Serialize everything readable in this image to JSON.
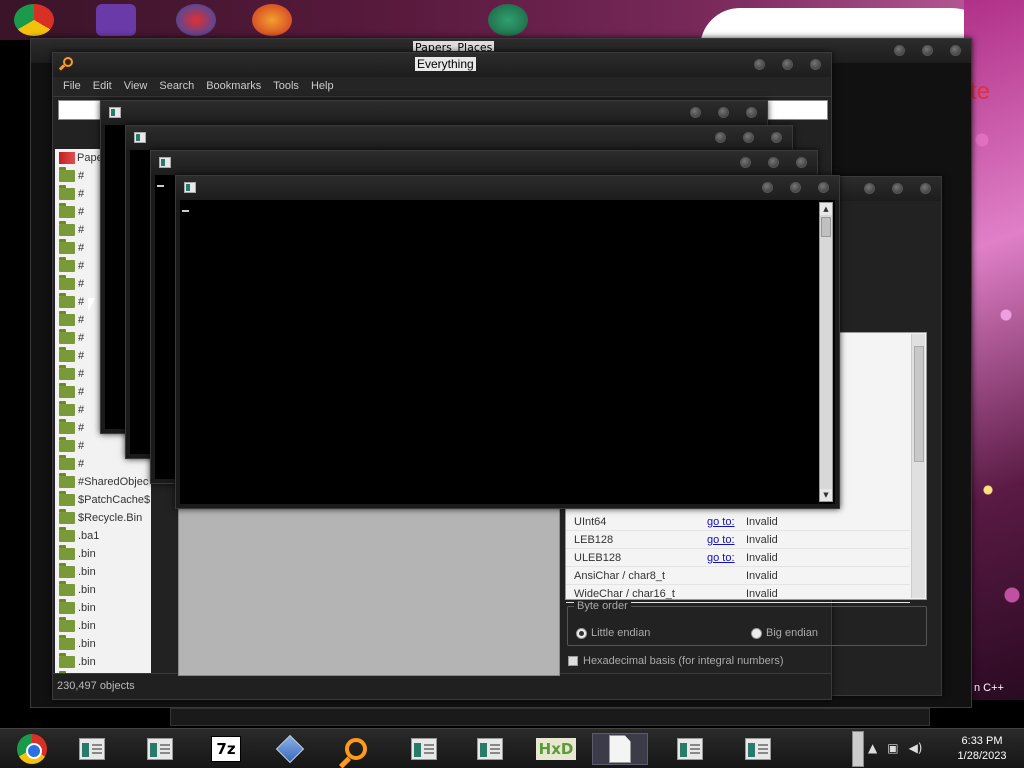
{
  "desktop": {
    "wallpaper_note_text": "te",
    "wallpaper_corner_text": "n C++"
  },
  "papers_window": {
    "title": "Papers_Places"
  },
  "everything": {
    "title": "Everything",
    "menu": [
      "File",
      "Edit",
      "View",
      "Search",
      "Bookmarks",
      "Tools",
      "Help"
    ],
    "search_value": "",
    "files": [
      {
        "name": "Pape",
        "icon": "paper-icon"
      },
      {
        "name": "#",
        "icon": "folder-icon"
      },
      {
        "name": "#",
        "icon": "folder-icon"
      },
      {
        "name": "#",
        "icon": "folder-icon"
      },
      {
        "name": "#",
        "icon": "folder-icon"
      },
      {
        "name": "#",
        "icon": "folder-icon"
      },
      {
        "name": "#",
        "icon": "folder-icon"
      },
      {
        "name": "#",
        "icon": "folder-icon"
      },
      {
        "name": "#",
        "icon": "folder-icon"
      },
      {
        "name": "#",
        "icon": "folder-icon"
      },
      {
        "name": "#",
        "icon": "folder-icon"
      },
      {
        "name": "#",
        "icon": "folder-icon"
      },
      {
        "name": "#",
        "icon": "folder-icon"
      },
      {
        "name": "#",
        "icon": "folder-icon"
      },
      {
        "name": "#",
        "icon": "folder-icon"
      },
      {
        "name": "#",
        "icon": "folder-icon"
      },
      {
        "name": "#",
        "icon": "folder-icon"
      },
      {
        "name": "#",
        "icon": "folder-icon"
      },
      {
        "name": "#SharedObjec",
        "icon": "folder-icon"
      },
      {
        "name": "$PatchCache$",
        "icon": "folder-icon"
      },
      {
        "name": "$Recycle.Bin",
        "icon": "folder-icon"
      },
      {
        "name": ".ba1",
        "icon": "folder-icon"
      },
      {
        "name": ".bin",
        "icon": "folder-icon"
      },
      {
        "name": ".bin",
        "icon": "folder-icon"
      },
      {
        "name": ".bin",
        "icon": "folder-icon"
      },
      {
        "name": ".bin",
        "icon": "folder-icon"
      },
      {
        "name": ".bin",
        "icon": "folder-icon"
      },
      {
        "name": ".bin",
        "icon": "folder-icon"
      },
      {
        "name": ".bin",
        "icon": "folder-icon"
      },
      {
        "name": ".bin",
        "icon": "folder-icon"
      }
    ],
    "status": "230,497 objects"
  },
  "inspector": {
    "rows": [
      {
        "name": "UInt64",
        "link": "go to:",
        "value": "Invalid"
      },
      {
        "name": "LEB128",
        "link": "go to:",
        "value": "Invalid"
      },
      {
        "name": "ULEB128",
        "link": "go to:",
        "value": "Invalid"
      },
      {
        "name": "AnsiChar / char8_t",
        "link": "",
        "value": "Invalid"
      },
      {
        "name": "WideChar / char16_t",
        "link": "",
        "value": "Invalid"
      }
    ],
    "byte_order_label": "Byte order",
    "little_endian": "Little endian",
    "big_endian": "Big endian",
    "selected_byte_order": "little",
    "hex_basis_label": "Hexadecimal basis (for integral numbers)"
  },
  "taskbar": {
    "items": [
      {
        "name": "chrome-taskbar-button",
        "icon": "chrome-icon"
      },
      {
        "name": "app-taskbar-button-1",
        "icon": "app-tile-icon"
      },
      {
        "name": "app-taskbar-button-2",
        "icon": "app-tile-icon"
      },
      {
        "name": "7zip-taskbar-button",
        "icon": "7z-icon",
        "label": "7z"
      },
      {
        "name": "diamond-taskbar-button",
        "icon": "diamond-icon"
      },
      {
        "name": "everything-taskbar-button",
        "icon": "search-icon"
      },
      {
        "name": "app-taskbar-button-3",
        "icon": "app-tile-icon"
      },
      {
        "name": "app-taskbar-button-4",
        "icon": "app-tile-icon"
      },
      {
        "name": "hxd-taskbar-button",
        "icon": "hxd-icon",
        "label": "HxD"
      },
      {
        "name": "document-taskbar-button",
        "icon": "document-icon"
      },
      {
        "name": "app-taskbar-button-5",
        "icon": "app-tile-icon"
      },
      {
        "name": "app-taskbar-button-6",
        "icon": "app-tile-icon"
      }
    ],
    "time": "6:33 PM",
    "date": "1/28/2023"
  }
}
